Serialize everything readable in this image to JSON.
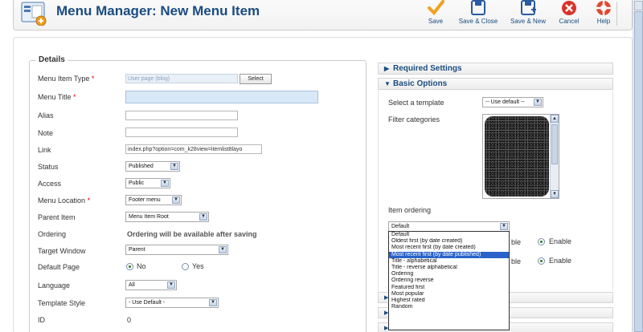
{
  "header": {
    "title": "Menu Manager: New Menu Item",
    "toolbar": [
      {
        "name": "save-button",
        "label": "Save",
        "icon": "check-icon",
        "color": "#f0a020"
      },
      {
        "name": "save-close-button",
        "label": "Save & Close",
        "icon": "save-close-icon",
        "color": "#2a5aa0"
      },
      {
        "name": "save-new-button",
        "label": "Save & New",
        "icon": "save-new-icon",
        "color": "#2a5aa0"
      },
      {
        "name": "cancel-button",
        "label": "Cancel",
        "icon": "cancel-icon",
        "color": "#d9342b"
      },
      {
        "name": "help-button",
        "label": "Help",
        "icon": "help-lifebuoy-icon",
        "color": "#e0492d"
      }
    ]
  },
  "details": {
    "legend": "Details",
    "menu_item_type_label": "Menu Item Type",
    "menu_item_type_value": "User page (blog)",
    "select_button": "Select",
    "menu_title_label": "Menu Title",
    "alias_label": "Alias",
    "note_label": "Note",
    "link_label": "Link",
    "link_value": "index.php?option=com_k28view=itemlist8layo",
    "status_label": "Status",
    "status_value": "Published",
    "access_label": "Access",
    "access_value": "Public",
    "menu_location_label": "Menu Location",
    "menu_location_value": "Footer menu",
    "parent_item_label": "Parent Item",
    "parent_item_value": "Menu Item Root",
    "ordering_label": "Ordering",
    "ordering_value": "Ordering will be available after saving",
    "target_window_label": "Target Window",
    "target_window_value": "Parent",
    "default_page_label": "Default Page",
    "default_page_no": "No",
    "default_page_yes": "Yes",
    "language_label": "Language",
    "language_value": "All",
    "template_style_label": "Template Style",
    "template_style_value": "- Use Default -",
    "id_label": "ID",
    "id_value": "0",
    "required_mark": "*"
  },
  "right": {
    "required_settings": "Required Settings",
    "basic_options": "Basic Options",
    "select_template_label": "Select a template",
    "select_template_value": "-- Use default --",
    "filter_categories_label": "Filter categories",
    "item_ordering_label": "Item ordering",
    "item_ordering_value": "Default",
    "ordering_options": [
      "Default",
      "Oldest first (by date created)",
      "Most recent first (by date created)",
      "Most recent first (by date published)",
      "Title - alphabetical",
      "Title - reverse alphabetical",
      "Ordering",
      "Ordering reverse",
      "Featured first",
      "Most popular",
      "Highest rated",
      "Random"
    ],
    "highlighted_index": 3,
    "enable_partial_1": "ble",
    "enable_1": "Enable",
    "enable_partial_2": "ble",
    "enable_2": "Enable"
  }
}
